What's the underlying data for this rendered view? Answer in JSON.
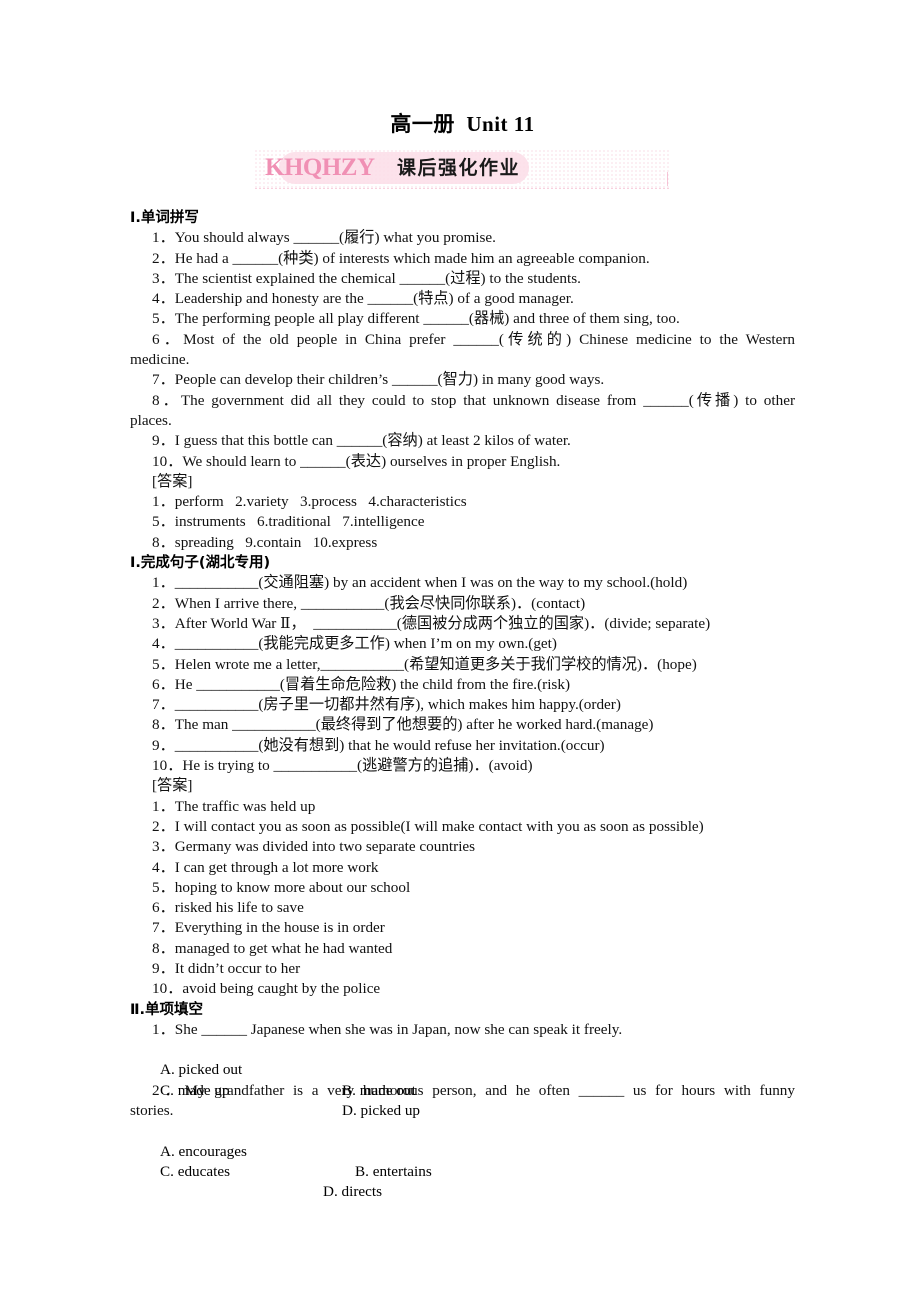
{
  "document": {
    "title": "高一册  Unit 11",
    "banner": {
      "logo": "KHQHZY",
      "label": "课后强化作业",
      "accent_color": "#f090b4",
      "pill_color": "#fbdde7"
    }
  },
  "sections": [
    {
      "heading": "Ⅰ.单词拼写",
      "questions": [
        "1．You should always ______(履行) what you promise.",
        "2．He had a ______(种类) of interests which made him an agreeable companion.",
        "3．The scientist explained the chemical ______(过程) to the students.",
        "4．Leadership and honesty are the ______(特点) of a good manager.",
        "5．The performing people all play different ______(器械) and three of them sing, too.",
        "6．Most of the old people in China prefer ______(传统的) Chinese medicine to the Western",
        "medicine.",
        "7．People can develop their children’s ______(智力) in many good ways.",
        "8．The government did all they could to stop that unknown disease from ______(传播) to other",
        "places.",
        "9．I guess that this bottle can ______(容纳) at least 2 kilos of water.",
        "10．We should learn to ______(表达) ourselves in proper English."
      ],
      "answer_label": "[答案]",
      "answers": [
        "1．perform   2.variety   3.process   4.characteristics",
        "5．instruments   6.traditional   7.intelligence",
        "8．spreading   9.contain   10.express"
      ]
    },
    {
      "heading": "Ⅰ.完成句子(湖北专用)",
      "questions": [
        "1．___________(交通阻塞) by an accident when I was on the way to my school.(hold)",
        "2．When I arrive there, ___________(我会尽快同你联系)．(contact)",
        "3．After World War Ⅱ，  ___________(德国被分成两个独立的国家)．(divide; separate)",
        "4．___________(我能完成更多工作) when I’m on my own.(get)",
        "5．Helen wrote me a letter,___________(希望知道更多关于我们学校的情况)．(hope)",
        "6．He ___________(冒着生命危险救) the child from the fire.(risk)",
        "7．___________(房子里一切都井然有序), which makes him happy.(order)",
        "8．The man ___________(最终得到了他想要的) after he worked hard.(manage)",
        "9．___________(她没有想到) that he would refuse her invitation.(occur)",
        "10．He is trying to ___________(逃避警方的追捕)．(avoid)"
      ],
      "answer_label": "[答案]",
      "answers": [
        "1．The traffic was held up",
        "2．I will contact you as soon as possible(I will make contact with you as soon as possible)",
        "3．Germany was divided into two separate countries",
        "4．I can get through a lot more work",
        "5．hoping to know more about our school",
        "6．risked his life to save",
        "7．Everything in the house is in order",
        "8．managed to get what he had wanted",
        "9．It didn’t occur to her",
        "10．avoid being caught by the police"
      ]
    },
    {
      "heading": "Ⅱ.单项填空",
      "mc_items": [
        {
          "stem": "1．She ______ Japanese when she was in Japan, now she can speak it freely.",
          "stem_wrap": "",
          "options": [
            "A. picked out",
            "B. made out",
            "C. made up",
            "D. picked up"
          ]
        },
        {
          "stem": "2．My grandfather is a very humorous person, and he often ______ us for hours with funny",
          "stem_wrap": "stories.",
          "options": [
            "A. encourages",
            "B. entertains",
            "C. educates",
            "D. directs"
          ]
        }
      ]
    }
  ]
}
